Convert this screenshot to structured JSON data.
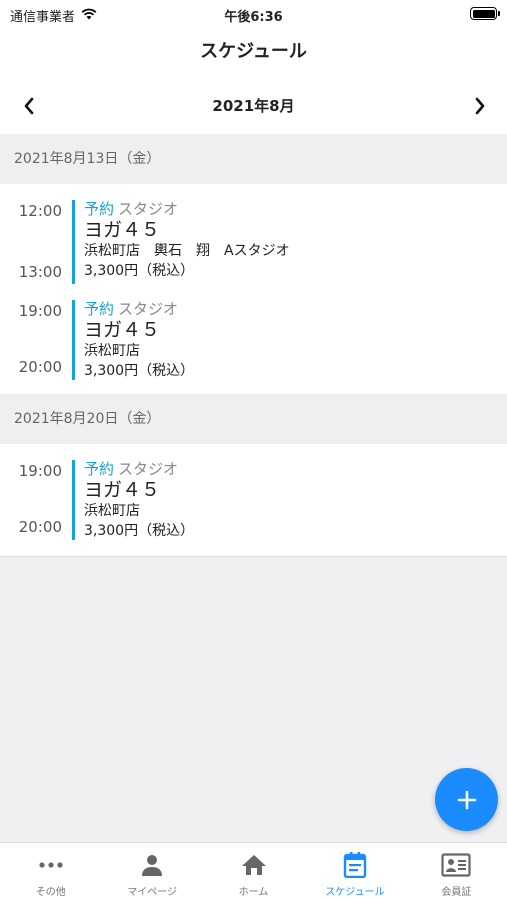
{
  "status_bar": {
    "carrier": "通信事業者",
    "time": "午後6:36"
  },
  "header": {
    "title": "スケジュール"
  },
  "month_nav": {
    "label": "2021年8月"
  },
  "days": [
    {
      "date": "2021年8月13日（金）",
      "events": [
        {
          "start": "12:00",
          "end": "13:00",
          "status": "予約",
          "type": "スタジオ",
          "name": "ヨガ４５",
          "location": "浜松町店　輿石　翔　Aスタジオ",
          "price": "3,300円（税込）"
        },
        {
          "start": "19:00",
          "end": "20:00",
          "status": "予約",
          "type": "スタジオ",
          "name": "ヨガ４５",
          "location": "浜松町店",
          "price": "3,300円（税込）"
        }
      ]
    },
    {
      "date": "2021年8月20日（金）",
      "events": [
        {
          "start": "19:00",
          "end": "20:00",
          "status": "予約",
          "type": "スタジオ",
          "name": "ヨガ４５",
          "location": "浜松町店",
          "price": "3,300円（税込）"
        }
      ]
    }
  ],
  "tabs": [
    {
      "label": "その他",
      "icon": "more-icon",
      "active": false
    },
    {
      "label": "マイページ",
      "icon": "person-icon",
      "active": false
    },
    {
      "label": "ホーム",
      "icon": "home-icon",
      "active": false
    },
    {
      "label": "スケジュール",
      "icon": "calendar-icon",
      "active": true
    },
    {
      "label": "会員証",
      "icon": "member-card-icon",
      "active": false
    }
  ],
  "colors": {
    "accent": "#1a8cff",
    "event_bar": "#1aa0e0",
    "inactive": "#777777"
  }
}
